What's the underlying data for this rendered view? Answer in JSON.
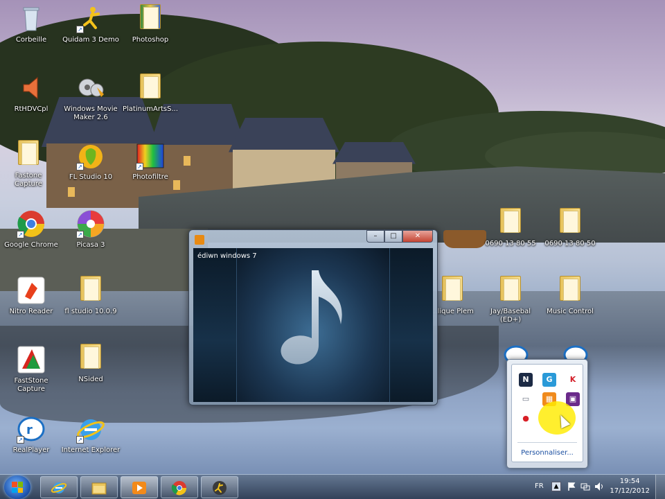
{
  "desktop": {
    "icons": [
      {
        "label": "Corbeille",
        "icon": "recycle-bin-icon"
      },
      {
        "label": "Quidam 3 Demo",
        "icon": "quidam-icon"
      },
      {
        "label": "Photoshop",
        "icon": "folder-icon"
      },
      {
        "label": "RtHDVCpl",
        "icon": "speaker-icon"
      },
      {
        "label": "Windows Movie\nMaker 2.6",
        "icon": "film-reel-icon"
      },
      {
        "label": "PlatinumArtsS...",
        "icon": "folder-icon"
      },
      {
        "label": "Fastone\nCapture",
        "icon": "folder-icon"
      },
      {
        "label": "FL Studio 10",
        "icon": "fl-studio-icon"
      },
      {
        "label": "Photofiltre",
        "icon": "photofiltre-icon"
      },
      {
        "label": "Google Chrome",
        "icon": "chrome-icon"
      },
      {
        "label": "Picasa 3",
        "icon": "picasa-icon"
      },
      {
        "label": "Nitro Reader",
        "icon": "nitro-reader-icon"
      },
      {
        "label": "fl studio 10.0.9",
        "icon": "folder-icon"
      },
      {
        "label": "FastStone\nCapture",
        "icon": "faststone-icon"
      },
      {
        "label": "NSided",
        "icon": "folder-icon"
      },
      {
        "label": "RealPlayer",
        "icon": "realplayer-icon"
      },
      {
        "label": "Internet Explorer",
        "icon": "internet-explorer-icon"
      },
      {
        "label": "0690 13 80 55",
        "icon": "folder-icon"
      },
      {
        "label": "0690 13 80 50",
        "icon": "folder-icon"
      },
      {
        "label": "...lique Plem",
        "icon": "folder-icon"
      },
      {
        "label": "Jay/Basebal\n(ED+)",
        "icon": "folder-icon"
      },
      {
        "label": "Music Control",
        "icon": "folder-icon"
      }
    ]
  },
  "media_player": {
    "caption": "édiwn windows 7",
    "minimize": "–",
    "maximize": "□",
    "close": "✕",
    "art_icon": "music-note-icon"
  },
  "tray_popup": {
    "customize_link": "Personnaliser...",
    "icons": [
      {
        "name": "network-app-icon",
        "glyph": "N",
        "color": "#1c2a44"
      },
      {
        "name": "shield-app-icon",
        "glyph": "G",
        "color": "#2a9ad8"
      },
      {
        "name": "kaspersky-icon",
        "glyph": "K",
        "color": "#d4202a"
      },
      {
        "name": "printer-icon",
        "glyph": "▭",
        "color": "#6b7280"
      },
      {
        "name": "orange-app-icon",
        "glyph": "▦",
        "color": "#f08a1c"
      },
      {
        "name": "purple-app-icon",
        "glyph": "▣",
        "color": "#6a2a8a"
      },
      {
        "name": "record-icon",
        "glyph": "●",
        "color": "#d81f26"
      }
    ]
  },
  "taskbar": {
    "language": "FR",
    "time": "19:54",
    "date": "17/12/2012",
    "apps": [
      {
        "name": "internet-explorer-icon"
      },
      {
        "name": "file-explorer-icon"
      },
      {
        "name": "media-player-icon"
      },
      {
        "name": "chrome-icon"
      },
      {
        "name": "quidam-icon"
      }
    ]
  }
}
